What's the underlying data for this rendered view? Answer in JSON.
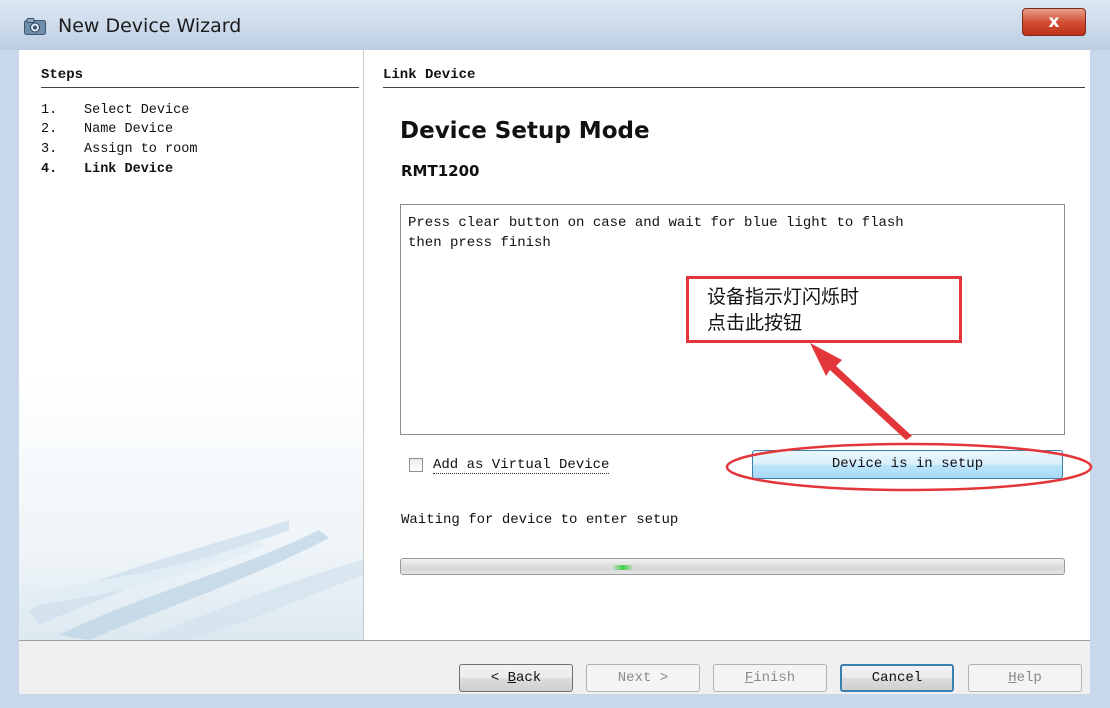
{
  "window": {
    "title": "New Device Wizard",
    "close_label": "x"
  },
  "steps": {
    "title": "Steps",
    "items": [
      {
        "num": "1.",
        "label": "Select Device",
        "active": false
      },
      {
        "num": "2.",
        "label": "Name Device",
        "active": false
      },
      {
        "num": "3.",
        "label": "Assign to room",
        "active": false
      },
      {
        "num": "4.",
        "label": "Link Device",
        "active": true
      }
    ]
  },
  "main": {
    "section_title": "Link Device",
    "heading": "Device Setup Mode",
    "model": "RMT1200",
    "instructions": "Press clear button on case and wait for blue light to flash\nthen press finish",
    "virtual_device_label": "Add as Virtual Device",
    "virtual_device_checked": false,
    "setup_button_label": "Device is in setup",
    "status_text": "Waiting for device to enter setup",
    "progress": "indeterminate"
  },
  "annotation": {
    "line1": "设备指示灯闪烁时",
    "line2": "点击此按钮",
    "color": "#e3363a"
  },
  "footer": {
    "back_label": "< Back",
    "next_label": "Next >",
    "finish_label": "Finish",
    "cancel_label": "Cancel",
    "help_label": "Help"
  }
}
